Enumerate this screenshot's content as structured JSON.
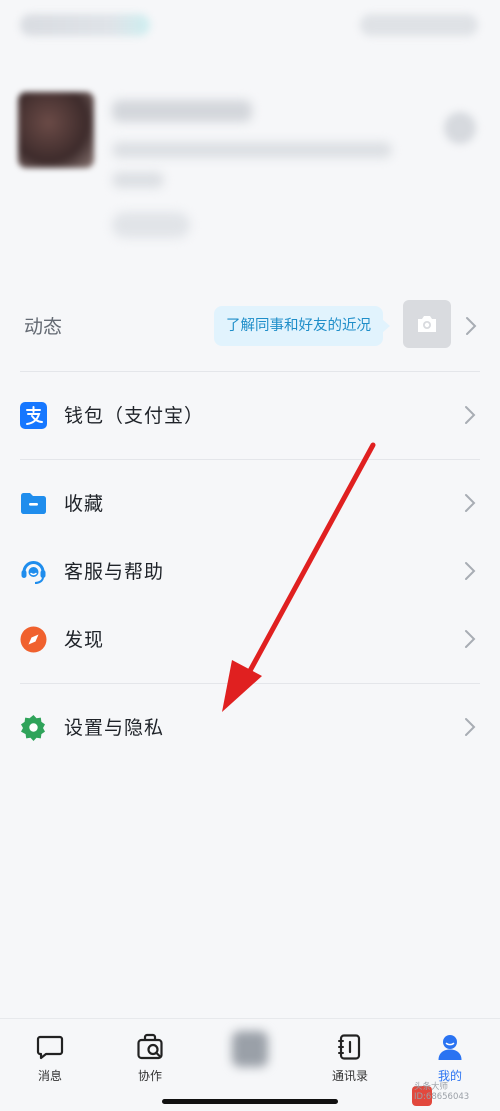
{
  "moments": {
    "label": "动态",
    "tooltip": "了解同事和好友的近况",
    "camera_icon": "camera-icon"
  },
  "menu": {
    "items": [
      {
        "label": "钱包（支付宝）",
        "icon": "alipay-icon",
        "color": "#1677ff"
      },
      {
        "label": "收藏",
        "icon": "folder-icon",
        "color": "#1f8ded"
      },
      {
        "label": "客服与帮助",
        "icon": "headset-icon",
        "color": "#1f8ded"
      },
      {
        "label": "发现",
        "icon": "compass-icon",
        "color": "#f0612e"
      },
      {
        "label": "设置与隐私",
        "icon": "gear-icon",
        "color": "#2fa35a"
      }
    ]
  },
  "tabbar": {
    "tabs": [
      {
        "label": "消息",
        "icon": "message-icon",
        "active": false
      },
      {
        "label": "协作",
        "icon": "collab-icon",
        "active": false
      },
      {
        "label": "通讯录",
        "icon": "contacts-icon",
        "active": false
      },
      {
        "label": "我的",
        "icon": "person-icon",
        "active": true
      }
    ],
    "active_color": "#2a73f2"
  },
  "annotation": {
    "arrow_color": "#e02020"
  },
  "watermark": {
    "line1": "头条大师",
    "line2": "ID:68656043"
  }
}
